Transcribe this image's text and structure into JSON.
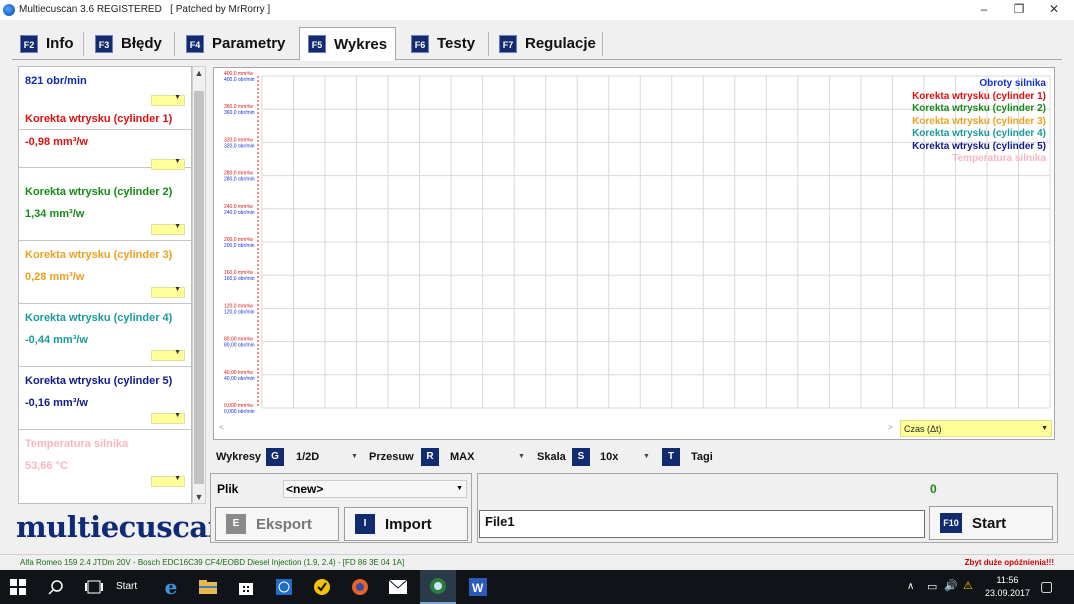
{
  "window": {
    "title": "Multiecuscan 3.6 REGISTERED   [ Patched by MrRorry ]",
    "minimize_glyph": "–",
    "maximize_glyph": "❐",
    "close_glyph": "✕"
  },
  "tabs": [
    {
      "key": "F2",
      "label": "Info"
    },
    {
      "key": "F3",
      "label": "Błędy"
    },
    {
      "key": "F4",
      "label": "Parametry"
    },
    {
      "key": "F5",
      "label": "Wykres"
    },
    {
      "key": "F6",
      "label": "Testy"
    },
    {
      "key": "F7",
      "label": "Regulacje"
    }
  ],
  "sensors": [
    {
      "name": "821 obr/min",
      "value": "",
      "color": "#0d2bb0",
      "sel": "1"
    },
    {
      "name": "Korekta wtrysku (cylinder 1)",
      "value": "-0,98 mm³/w",
      "color": "#e01010",
      "sel": "1"
    },
    {
      "name": "Korekta wtrysku (cylinder 2)",
      "value": "1,34 mm³/w",
      "color": "#168a16",
      "sel": "1"
    },
    {
      "name": "Korekta wtrysku (cylinder 3)",
      "value": "0,28 mm³/w",
      "color": "#f0a020",
      "sel": "1"
    },
    {
      "name": "Korekta wtrysku (cylinder 4)",
      "value": "-0,44 mm³/w",
      "color": "#1a9a9a",
      "sel": "1"
    },
    {
      "name": "Korekta wtrysku (cylinder 5)",
      "value": "-0,16 mm³/w",
      "color": "#101a8a",
      "sel": "1"
    },
    {
      "name": "Temperatura silnika",
      "value": "53,66 °C",
      "color": "#f7b6c2",
      "sel": "1"
    }
  ],
  "chart_data": {
    "type": "line",
    "y_axis_rpm_labels": [
      "400,0 obr/min",
      "360,0 obr/min",
      "320,0 obr/min",
      "280,0 obr/min",
      "240,0 obr/min",
      "200,0 obr/min",
      "160,0 obr/min",
      "120,0 obr/min",
      "80,00 obr/min",
      "40,00 obr/min",
      "0,000 obr/min"
    ],
    "y_axis_mm_labels": [
      "400,0 mm³/w",
      "360,0 mm³/w",
      "320,0 mm³/w",
      "280,0 mm³/w",
      "240,0 mm³/w",
      "200,0 mm³/w",
      "160,0 mm³/w",
      "120,0 mm³/w",
      "80,00 mm³/w",
      "40,00 mm³/w",
      "0,000 mm³/w"
    ],
    "ylim": [
      0,
      400
    ],
    "grid": true,
    "legend_placement": "top-right",
    "series": [
      {
        "name": "Obroty silnika",
        "color": "#1431d6",
        "values": []
      },
      {
        "name": "Korekta wtrysku (cylinder 1)",
        "color": "#e01010",
        "values": []
      },
      {
        "name": "Korekta wtrysku (cylinder 2)",
        "color": "#168a16",
        "values": []
      },
      {
        "name": "Korekta wtrysku (cylinder 3)",
        "color": "#f0a020",
        "values": []
      },
      {
        "name": "Korekta wtrysku (cylinder 4)",
        "color": "#1a9a9a",
        "values": []
      },
      {
        "name": "Korekta wtrysku (cylinder 5)",
        "color": "#101a8a",
        "values": []
      },
      {
        "name": "Temperatura silnika",
        "color": "#f7b6c2",
        "values": []
      }
    ]
  },
  "time_select": {
    "label": "Czas (Δt)"
  },
  "controls": {
    "wykresy_label": "Wykresy",
    "wykresy_key": "G",
    "wykresy_value": "1/2D",
    "przesuw_label": "Przesuw",
    "przesuw_key": "R",
    "przesuw_value": "MAX",
    "skala_label": "Skala",
    "skala_key": "S",
    "skala_value": "10x",
    "tagi_key": "T",
    "tagi_label": "Tagi"
  },
  "plik": {
    "label": "Plik",
    "value": "<new>"
  },
  "buttons": {
    "eksport_key": "E",
    "eksport_label": "Eksport",
    "import_key": "I",
    "import_label": "Import",
    "start_key": "F10",
    "start_label": "Start"
  },
  "record": {
    "count": "0",
    "filename": "File1"
  },
  "logo": {
    "text": "multiecuscan"
  },
  "status": {
    "vehicle": "Alfa Romeo 159 2.4 JTDm 20V - Bosch EDC16C39 CF4/EOBD Diesel Injection (1.9, 2.4) - [FD 86 3E 04 1A]",
    "warning": "Zbyt duże opóźnienia!!!"
  },
  "taskbar": {
    "start_label": "Start",
    "time": "11:56",
    "date": "23.09.2017"
  }
}
